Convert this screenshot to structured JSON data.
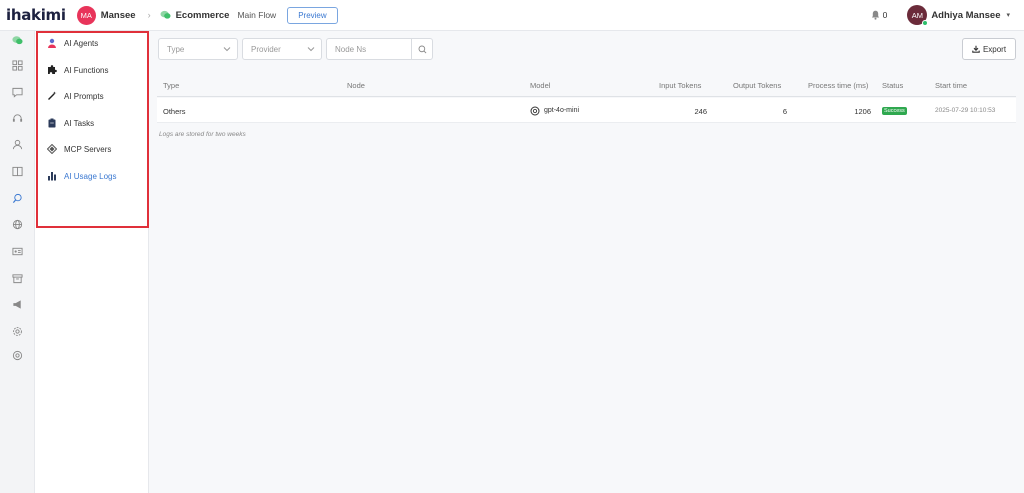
{
  "brand": {
    "logo": "ihakimi"
  },
  "header": {
    "workspace_initials": "MA",
    "workspace_name": "Mansee",
    "project_name": "Ecommerce",
    "flow_name": "Main Flow",
    "preview_label": "Preview",
    "notification_count": "0",
    "user_initials": "AM",
    "user_name": "Adhiya Mansee"
  },
  "rail": {
    "icons": [
      "chat-bubbles-icon",
      "dashboard-grid-icon",
      "message-icon",
      "headset-icon",
      "user-icon",
      "book-icon",
      "ai-brain-icon",
      "globe-icon",
      "id-card-icon",
      "archive-icon",
      "megaphone-icon",
      "settings-icon",
      "help-icon"
    ]
  },
  "subnav": {
    "items": [
      {
        "label": "AI Agents",
        "icon": "agent-icon",
        "active": false
      },
      {
        "label": "AI Functions",
        "icon": "puzzle-icon",
        "active": false
      },
      {
        "label": "AI Prompts",
        "icon": "magic-wand-icon",
        "active": false
      },
      {
        "label": "AI Tasks",
        "icon": "clipboard-icon",
        "active": false
      },
      {
        "label": "MCP Servers",
        "icon": "server-icon",
        "active": false
      },
      {
        "label": "AI Usage Logs",
        "icon": "bar-chart-icon",
        "active": true
      }
    ]
  },
  "filters": {
    "type_placeholder": "Type",
    "provider_placeholder": "Provider",
    "node_placeholder": "Node Ns"
  },
  "toolbar": {
    "export_label": "Export"
  },
  "table": {
    "columns": [
      "Type",
      "Node",
      "Model",
      "Input Tokens",
      "Output Tokens",
      "Process time (ms)",
      "Status",
      "Start time"
    ],
    "rows": [
      {
        "type": "Others",
        "node": "",
        "model": "gpt-4o-mini",
        "input_tokens": "246",
        "output_tokens": "6",
        "process_time": "1206",
        "status": "Success",
        "start_time": "2025-07-29 10:10:53"
      }
    ]
  },
  "footer_note": "Logs are stored for two weeks",
  "colors": {
    "accent": "#3a78d1",
    "brand": "#e8345a",
    "success": "#2fa84f",
    "highlight": "#e0303a"
  }
}
